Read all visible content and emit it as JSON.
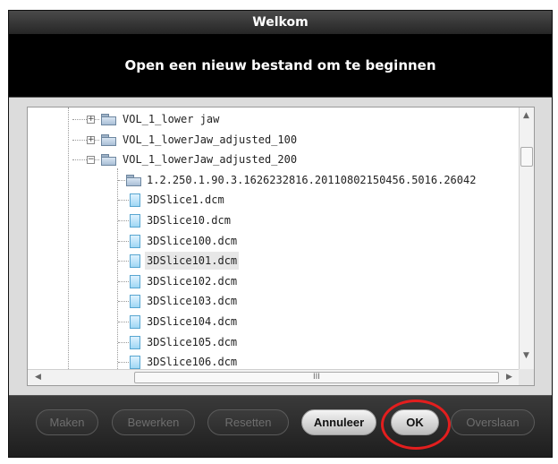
{
  "window": {
    "title": "Welkom",
    "header": "Open een nieuw bestand om te beginnen"
  },
  "tree": {
    "items": [
      {
        "label": "VOL_1_lower jaw",
        "type": "folder",
        "expander": "+"
      },
      {
        "label": "VOL_1_lowerJaw_adjusted_100",
        "type": "folder",
        "expander": "+"
      },
      {
        "label": "VOL_1_lowerJaw_adjusted_200",
        "type": "folder",
        "expander": "−"
      },
      {
        "label": "1.2.250.1.90.3.1626232816.20110802150456.5016.26042",
        "type": "folder"
      },
      {
        "label": "3DSlice1.dcm",
        "type": "file"
      },
      {
        "label": "3DSlice10.dcm",
        "type": "file"
      },
      {
        "label": "3DSlice100.dcm",
        "type": "file"
      },
      {
        "label": "3DSlice101.dcm",
        "type": "file",
        "selected": true
      },
      {
        "label": "3DSlice102.dcm",
        "type": "file"
      },
      {
        "label": "3DSlice103.dcm",
        "type": "file"
      },
      {
        "label": "3DSlice104.dcm",
        "type": "file"
      },
      {
        "label": "3DSlice105.dcm",
        "type": "file"
      },
      {
        "label": "3DSlice106.dcm",
        "type": "file"
      }
    ],
    "scroll_up_icon": "▲",
    "scroll_down_icon": "▼",
    "scroll_left_icon": "◀",
    "scroll_right_icon": "▶",
    "grip_icon": "III"
  },
  "buttons": {
    "maken": "Maken",
    "bewerken": "Bewerken",
    "resetten": "Resetten",
    "annuleer": "Annuleer",
    "ok": "OK",
    "overslaan": "Overslaan"
  },
  "colors": {
    "highlight_circle": "#e31e1e",
    "header_bg": "#000000",
    "panel_bg": "#dcdcdc"
  }
}
